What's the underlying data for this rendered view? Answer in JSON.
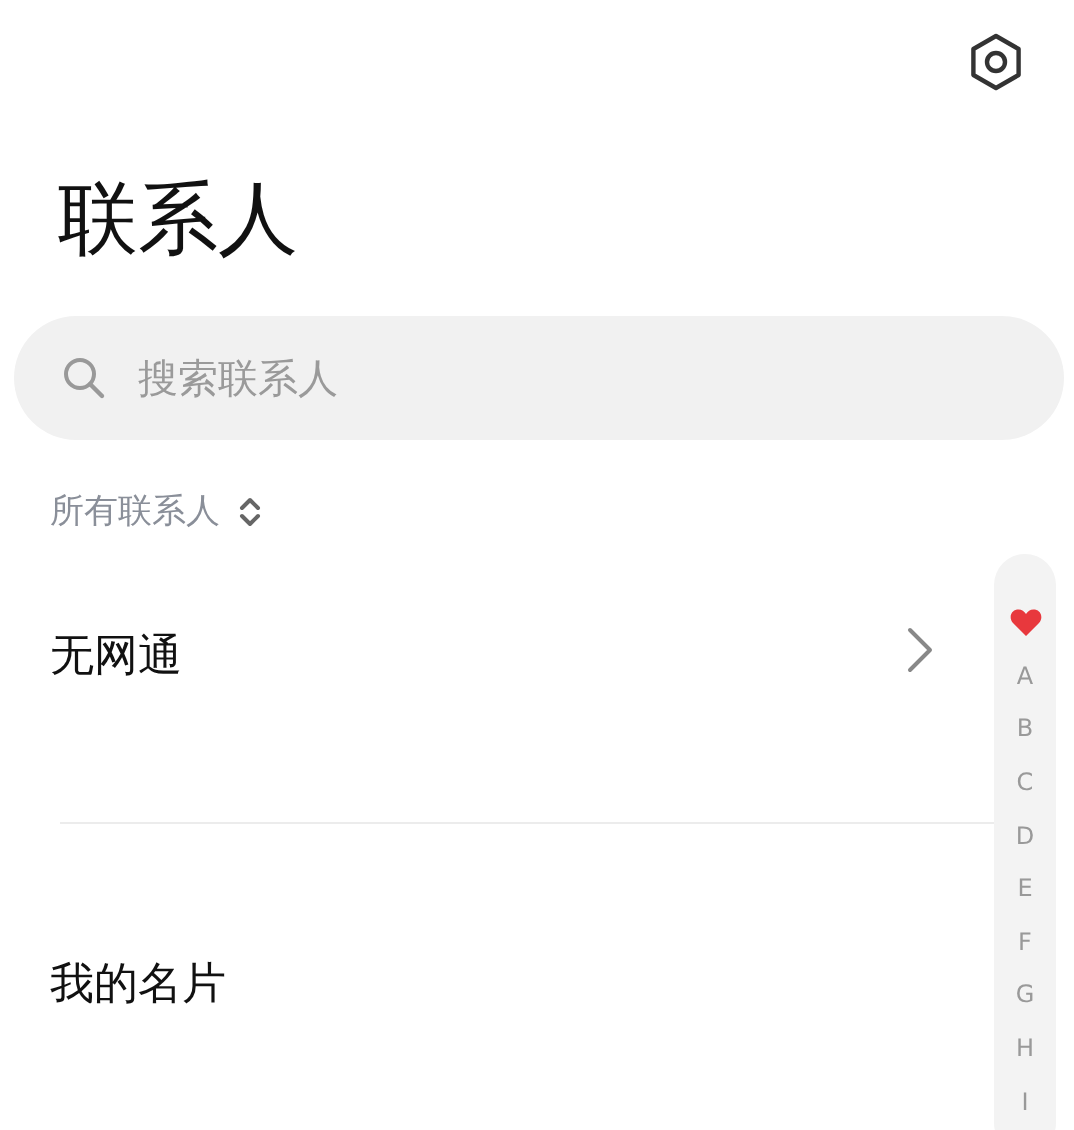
{
  "title": "联系人",
  "search": {
    "placeholder": "搜索联系人"
  },
  "filter": {
    "label": "所有联系人"
  },
  "contacts": [
    {
      "name": "无网通",
      "chevron": true
    },
    {
      "name": "我的名片",
      "chevron": false
    }
  ],
  "index_bar": [
    {
      "kind": "favorite"
    },
    {
      "kind": "letter",
      "label": "A"
    },
    {
      "kind": "letter",
      "label": "B"
    },
    {
      "kind": "letter",
      "label": "C"
    },
    {
      "kind": "letter",
      "label": "D"
    },
    {
      "kind": "letter",
      "label": "E"
    },
    {
      "kind": "letter",
      "label": "F"
    },
    {
      "kind": "letter",
      "label": "G"
    },
    {
      "kind": "letter",
      "label": "H"
    },
    {
      "kind": "letter",
      "label": "I"
    }
  ]
}
